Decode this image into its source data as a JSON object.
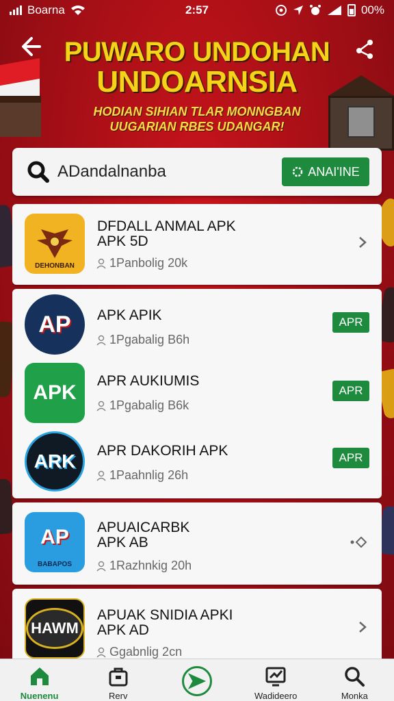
{
  "status_bar": {
    "carrier": "Boarna",
    "time": "2:57",
    "battery_text": "00%"
  },
  "header": {
    "title_line1": "PUWARO UNDOHAN",
    "title_line2": "UNDOARNSIA",
    "subtitle_line1": "HODIAN SIHIAN TLAR MONNGBAN",
    "subtitle_line2": "UUGARIAN RBES UDANGAR!"
  },
  "search": {
    "value": "ADandalnanba",
    "button_label": "ANAI'INE"
  },
  "apps": [
    {
      "name": "DFDALL ANMAL APK",
      "name2": "APK 5D",
      "meta": "1Panbolig 20k",
      "icon_label": "DEHONBAN",
      "action": "chevron"
    },
    {
      "name": "APK APIK",
      "name2": "",
      "meta": "1Pgabalig B6h",
      "icon_text": "AP",
      "action": "badge",
      "badge": "APR"
    },
    {
      "name": "APR AUKIUMIS",
      "name2": "",
      "meta": "1Pgabalig B6k",
      "icon_text": "APK",
      "action": "badge",
      "badge": "APR"
    },
    {
      "name": "APR DAKORIH APK",
      "name2": "",
      "meta": "1Paahnlig 26h",
      "icon_text": "ARK",
      "action": "badge",
      "badge": "APR"
    },
    {
      "name": "APUAICARBK",
      "name2": "APK AB",
      "meta": "1Razhnkig 20h",
      "icon_text": "AP",
      "icon_label": "BABAPOS",
      "action": "radio"
    },
    {
      "name": "APUAK SNIDIA APKI",
      "name2": "APK AD",
      "meta": "Ggabnlig 2cn",
      "icon_text": "HAWM",
      "action": "chevron"
    }
  ],
  "bottom_nav": [
    {
      "label": "Nuenenu",
      "icon": "home-icon",
      "active": true
    },
    {
      "label": "Rerv",
      "icon": "bag-icon",
      "active": false
    },
    {
      "label": "",
      "icon": "send-icon",
      "active": false
    },
    {
      "label": "Wadideero",
      "icon": "chart-icon",
      "active": false
    },
    {
      "label": "Monka",
      "icon": "search-icon",
      "active": false
    }
  ],
  "colors": {
    "background_red": "#a00e15",
    "accent_green": "#1e8a3e",
    "title_yellow": "#f7d21b"
  }
}
